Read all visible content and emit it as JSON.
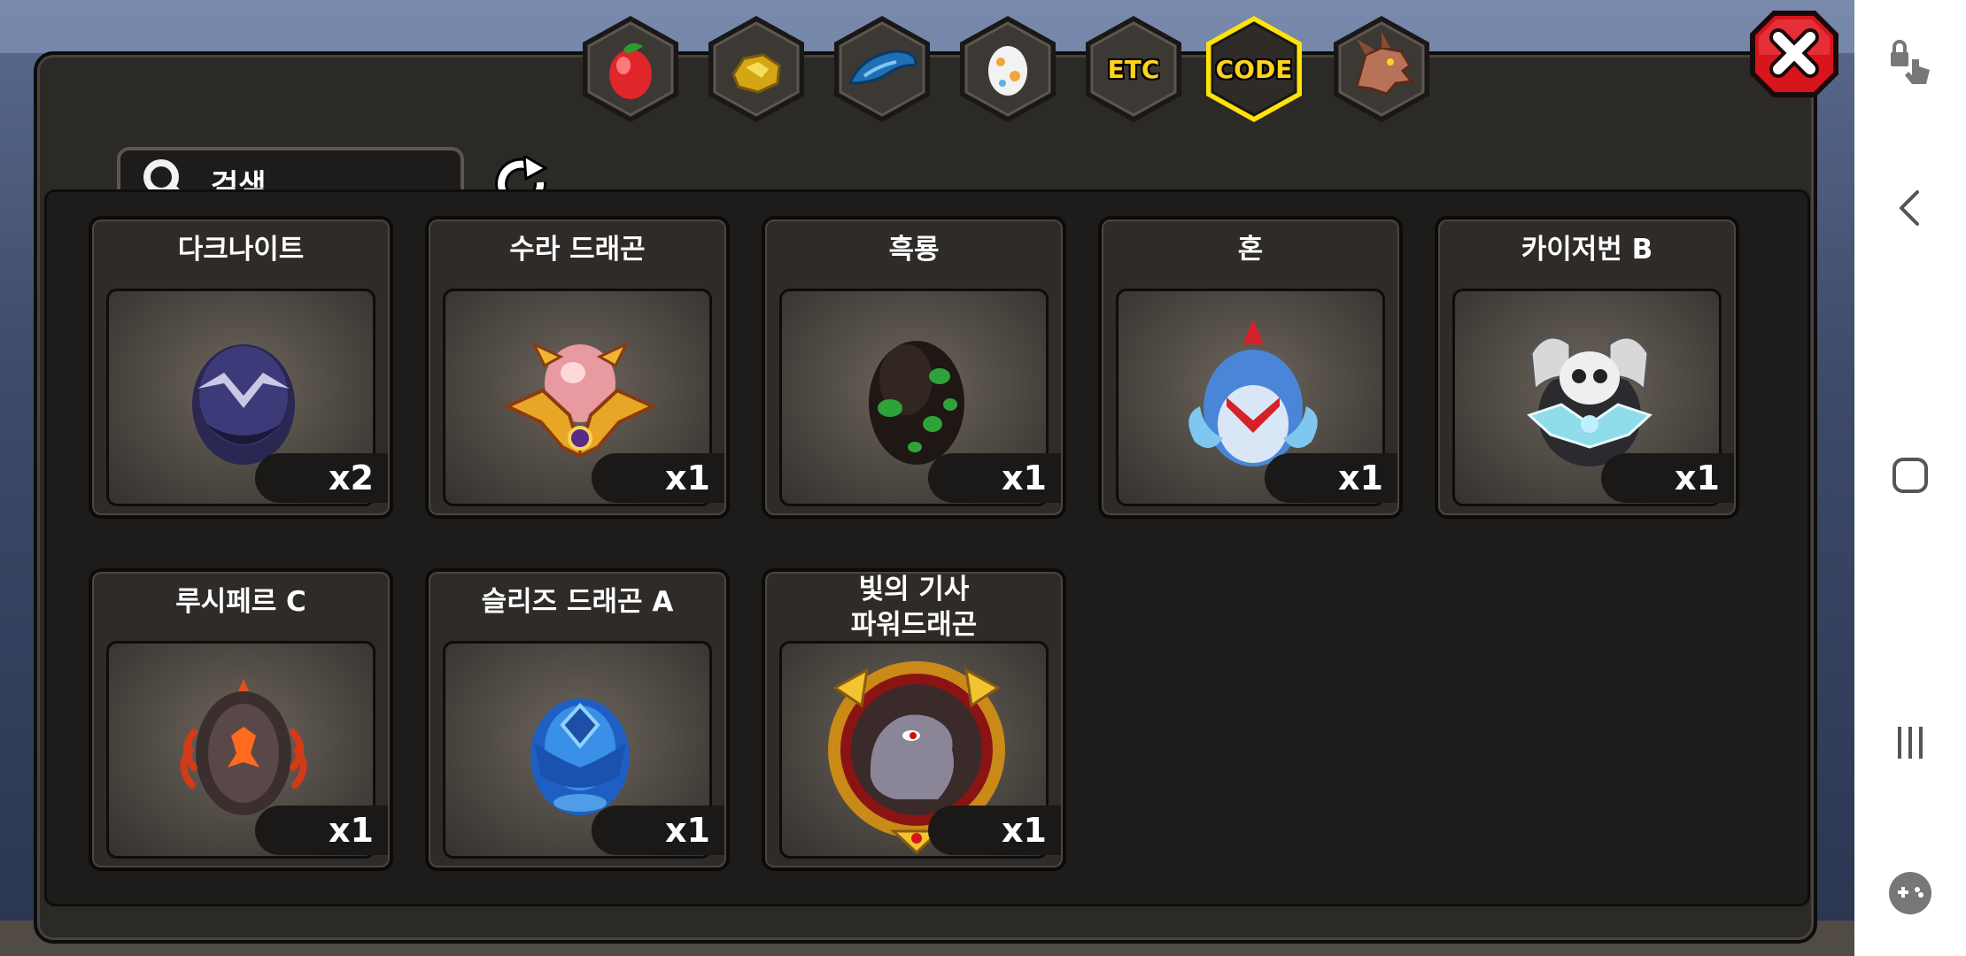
{
  "search": {
    "label": "검색"
  },
  "tabs": [
    {
      "id": "fruit",
      "icon": "red-fruit-icon",
      "label": ""
    },
    {
      "id": "ore",
      "icon": "gold-ore-icon",
      "label": ""
    },
    {
      "id": "scale",
      "icon": "blue-scale-icon",
      "label": ""
    },
    {
      "id": "egg",
      "icon": "spotted-egg-icon",
      "label": ""
    },
    {
      "id": "etc",
      "icon": "",
      "label": "ETC"
    },
    {
      "id": "code",
      "icon": "",
      "label": "CODE",
      "selected": true
    },
    {
      "id": "dragon",
      "icon": "dragon-head-icon",
      "label": ""
    }
  ],
  "items": [
    {
      "name": "다크나이트",
      "count": "x2",
      "icon": "dark-knight-egg-icon"
    },
    {
      "name": "수라 드래곤",
      "count": "x1",
      "icon": "sura-dragon-egg-icon"
    },
    {
      "name": "흑룡",
      "count": "x1",
      "icon": "black-dragon-egg-icon"
    },
    {
      "name": "혼",
      "count": "x1",
      "icon": "hon-egg-icon"
    },
    {
      "name": "카이저번 B",
      "count": "x1",
      "icon": "kaiserburn-b-egg-icon"
    },
    {
      "name": "루시페르 C",
      "count": "x1",
      "icon": "lucifer-c-egg-icon"
    },
    {
      "name": "슬리즈 드래곤 A",
      "count": "x1",
      "icon": "sleaze-dragon-a-egg-icon"
    },
    {
      "name": "빛의 기사\n파워드래곤",
      "name_line1": "빛의 기사",
      "name_line2": "파워드래곤",
      "count": "x1",
      "icon": "power-dragon-medal-icon"
    }
  ],
  "colors": {
    "selected_tab_border": "#ffe20a",
    "close_button": "#d8151c",
    "panel": "#2c2a27"
  }
}
